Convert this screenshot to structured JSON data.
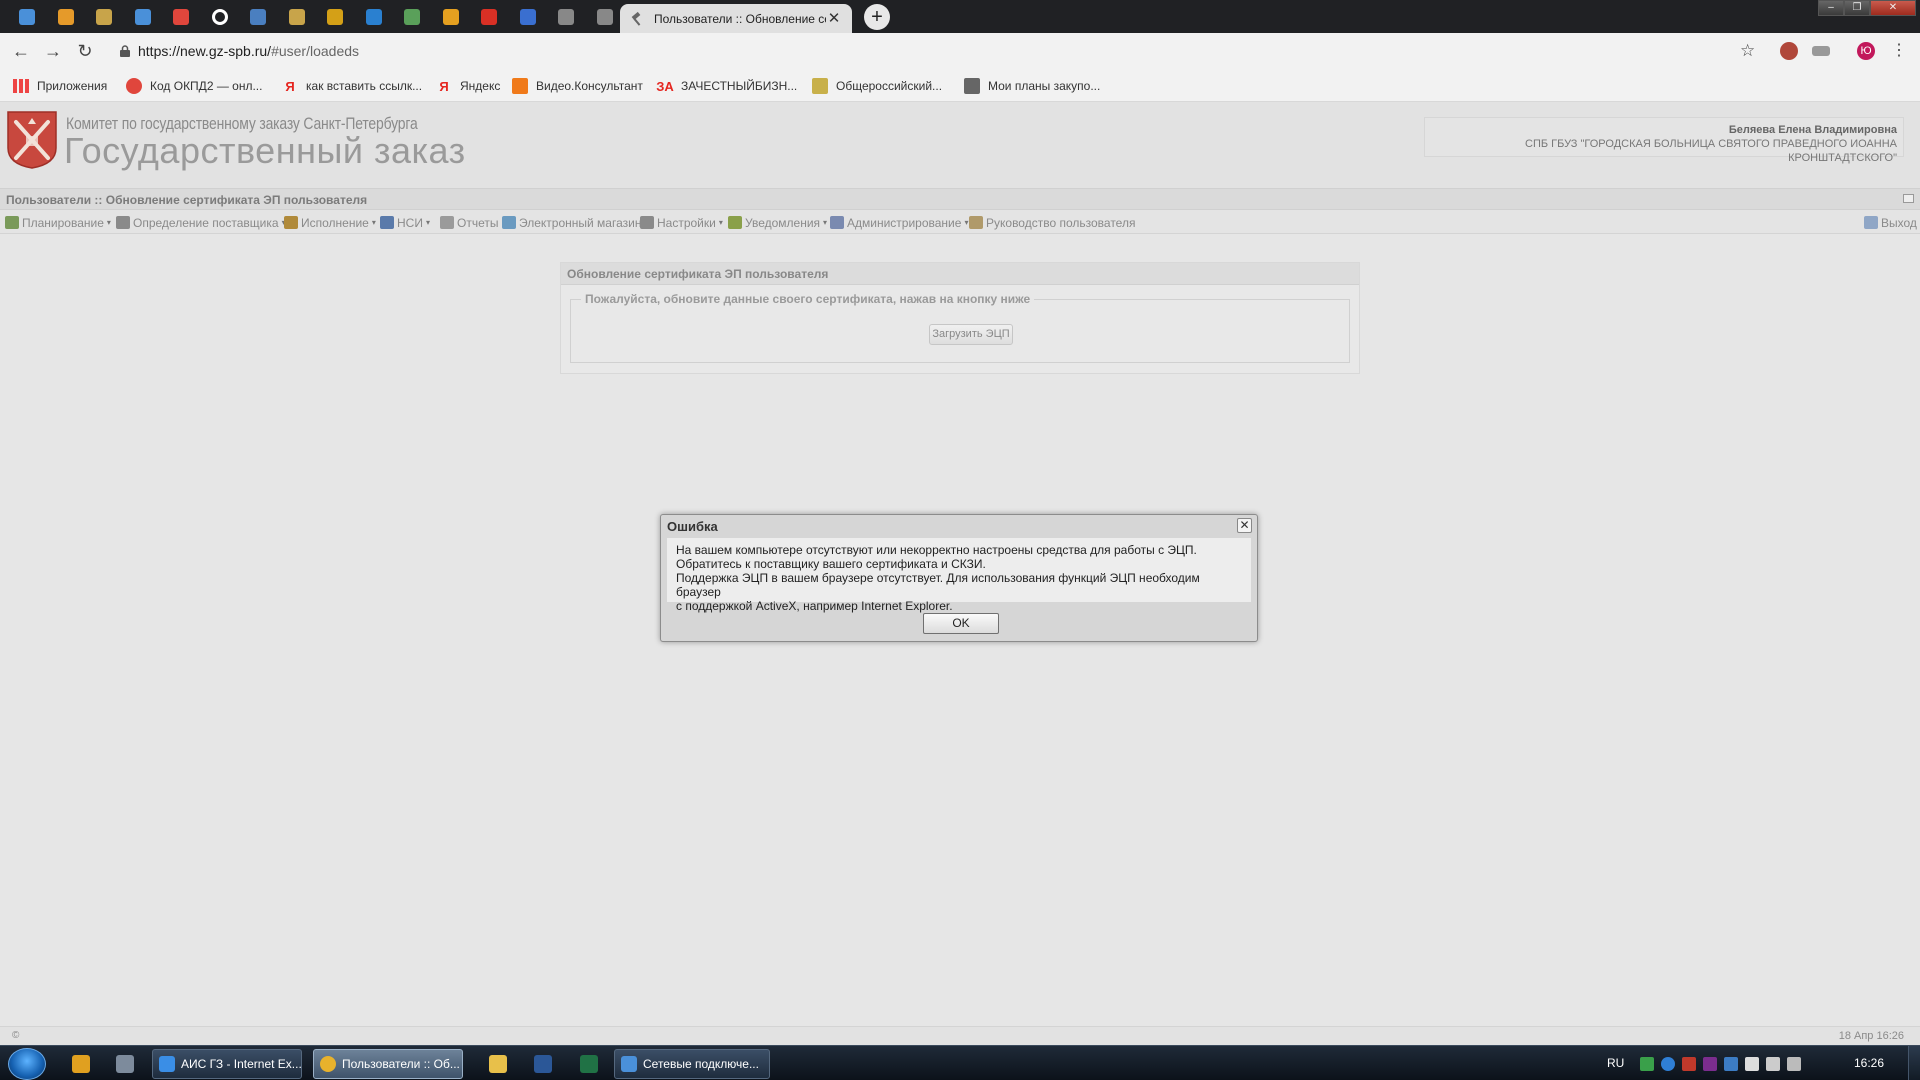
{
  "browser": {
    "active_tab_title": "Пользователи :: Обновление се",
    "tab_close": "✕",
    "new_tab": "+",
    "url_host": "https://new.gz-spb.ru/",
    "url_path": "#user/loadeds",
    "profile_initial": "Ю",
    "pinned_tab_icons": [
      "chat-icon",
      "hands-icon",
      "emblem-icon",
      "home-icon",
      "pocket-icon",
      "circle-g-icon",
      "tree-icon",
      "emblem-icon",
      "fist-icon",
      "bird-icon",
      "flag-icon",
      "envelope-icon",
      "gmail-icon",
      "target-icon",
      "gavel-icon",
      "gavel-icon"
    ],
    "colors": {
      "tabbar": "#202124",
      "toolbar": "#f2f2f2",
      "profile": "#c2185b"
    }
  },
  "bookmarks": [
    {
      "label": "Приложения",
      "icon": "apps-grid-icon"
    },
    {
      "label": "Код ОКПД2 — онл...",
      "icon": "pocket-icon"
    },
    {
      "label": "как вставить ссылк...",
      "icon": "yandex-icon",
      "glyph": "Я"
    },
    {
      "label": "Яндекс",
      "icon": "yandex-icon",
      "glyph": "Я"
    },
    {
      "label": "Видео.Консультант",
      "icon": "video-icon"
    },
    {
      "label": "ЗАЧЕСТНЫЙБИЗН...",
      "icon": "za-icon",
      "glyph": "ЗА"
    },
    {
      "label": "Общероссийский...",
      "icon": "list-icon"
    },
    {
      "label": "Мои планы закупо...",
      "icon": "gavel-icon"
    }
  ],
  "header": {
    "org_name": "Комитет по государственному заказу Санкт-Петербурга",
    "site_title": "Государственный заказ",
    "user_name": "Беляева Елена Владимировна",
    "user_org": "СПБ ГБУЗ \"ГОРОДСКАЯ БОЛЬНИЦА СВЯТОГО ПРАВЕДНОГО ИОАННА КРОНШТАДТСКОГО\""
  },
  "breadcrumb": "Пользователи :: Обновление сертификата ЭП пользователя",
  "menu": [
    {
      "label": "Планирование",
      "dropdown": true
    },
    {
      "label": "Определение поставщика",
      "dropdown": true
    },
    {
      "label": "Исполнение",
      "dropdown": true
    },
    {
      "label": "НСИ",
      "dropdown": true
    },
    {
      "label": "Отчеты",
      "dropdown": false
    },
    {
      "label": "Электронный магазин",
      "dropdown": false
    },
    {
      "label": "Настройки",
      "dropdown": true
    },
    {
      "label": "Уведомления",
      "dropdown": true
    },
    {
      "label": "Администрирование",
      "dropdown": true
    },
    {
      "label": "Руководство пользователя",
      "dropdown": false
    }
  ],
  "menu_arrow": "▾",
  "logout_label": "Выход",
  "cert_panel": {
    "title": "Обновление сертификата ЭП пользователя",
    "legend": "Пожалуйста, обновите данные своего сертификата, нажав на кнопку ниже",
    "button": "Загрузить ЭЦП"
  },
  "dialog": {
    "title": "Ошибка",
    "close": "✕",
    "lines": [
      "На вашем компьютере отсутствуют или некорректно настроены средства для работы с ЭЦП.",
      "Обратитесь к поставщику вашего сертификата и СКЗИ.",
      "Поддержка ЭЦП в вашем браузере отсутствует. Для использования функций ЭЦП необходим браузер",
      "с поддержкой ActiveX, например Internet Explorer."
    ],
    "ok": "OK"
  },
  "status": {
    "left": "©",
    "right": "18 Апр 16:26"
  },
  "taskbar": {
    "tasks": [
      {
        "label": "АИС ГЗ - Internet Ex...",
        "icon": "ie-icon",
        "active": false
      },
      {
        "label": "Пользователи :: Об...",
        "icon": "chrome-icon",
        "active": true
      },
      {
        "label": "Сетевые подключе...",
        "icon": "network-icon",
        "active": false
      }
    ],
    "lang": "RU",
    "clock": "16:26"
  }
}
